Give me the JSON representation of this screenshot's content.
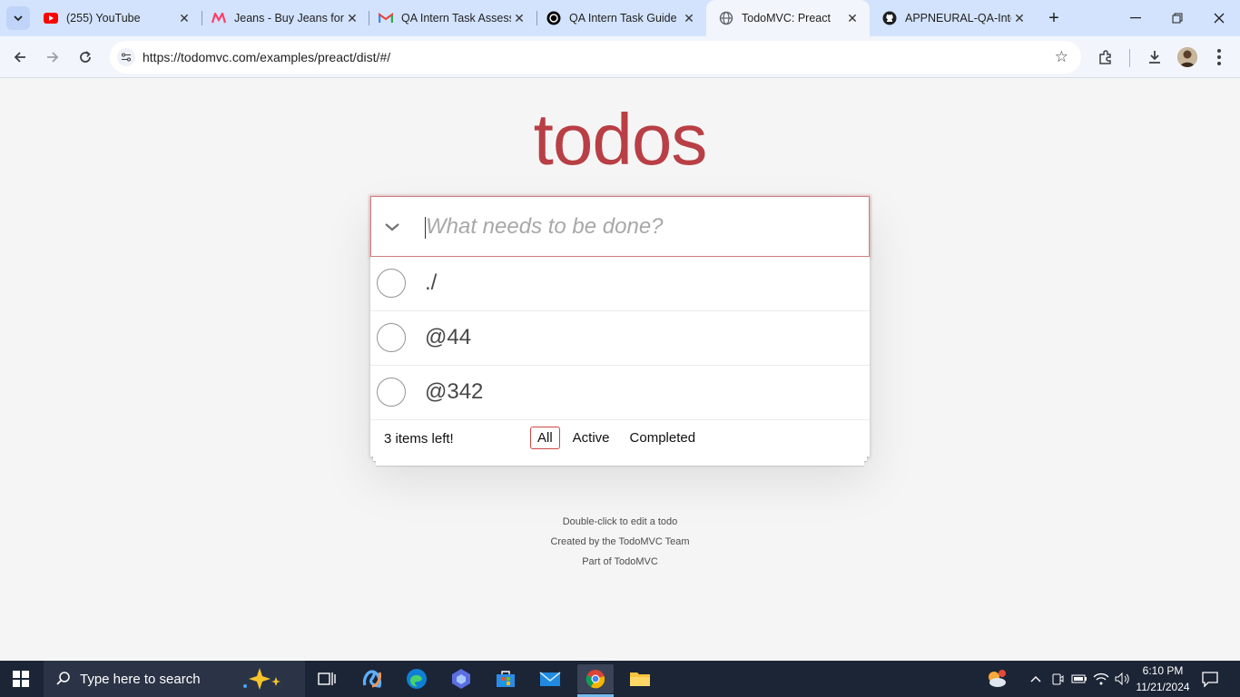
{
  "browser": {
    "tabs": [
      {
        "title": "(255) YouTube",
        "icon": "youtube-icon"
      },
      {
        "title": "Jeans - Buy Jeans for",
        "icon": "myntra-icon"
      },
      {
        "title": "QA Intern Task Assess",
        "icon": "gmail-icon"
      },
      {
        "title": "QA Intern Task Guide",
        "icon": "chatgpt-icon"
      },
      {
        "title": "TodoMVC: Preact",
        "icon": "globe-icon",
        "active": true
      },
      {
        "title": "APPNEURAL-QA-Inte",
        "icon": "github-icon"
      }
    ],
    "url": "https://todomvc.com/examples/preact/dist/#/",
    "new_tab": "+",
    "close_glyph": "✕"
  },
  "app": {
    "title": "todos",
    "input_placeholder": "What needs to be done?",
    "todos": [
      {
        "label": "./",
        "completed": false
      },
      {
        "label": "@44",
        "completed": false
      },
      {
        "label": "@342",
        "completed": false
      }
    ],
    "footer": {
      "count_text": "3 items left!",
      "filters": [
        "All",
        "Active",
        "Completed"
      ],
      "selected_filter": "All"
    },
    "info": [
      "Double-click to edit a todo",
      "Created by the TodoMVC Team",
      "Part of TodoMVC"
    ]
  },
  "taskbar": {
    "search_placeholder": "Type here to search",
    "time": "6:10 PM",
    "date": "11/21/2024"
  },
  "colors": {
    "title": "#b83f45",
    "accent_border": "#ce4646",
    "taskbar": "#1c2536",
    "tabstrip": "#d3e3fd"
  }
}
